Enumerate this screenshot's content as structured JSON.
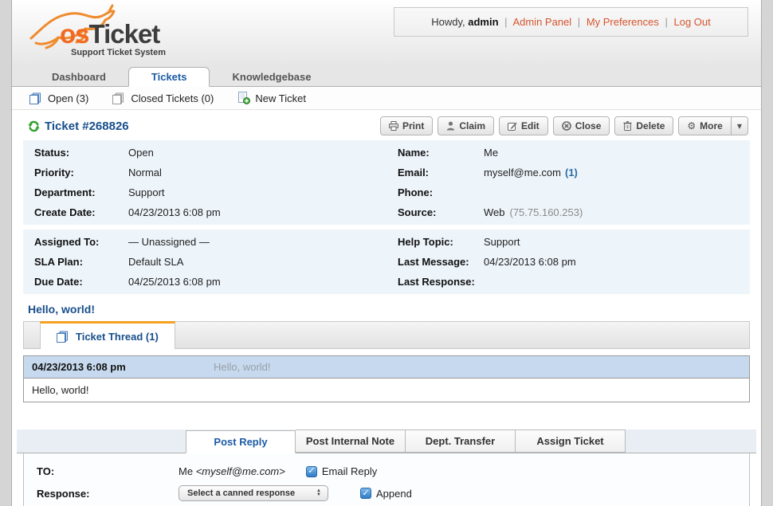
{
  "colors": {
    "link_orange": "#d4552e",
    "heading_blue": "#184f8c",
    "active_tab_blue": "#1d5ba5",
    "thread_tab_accent": "#f5a01e",
    "panel_bg": "#edf4fa",
    "message_header_bg": "#c6d9ee"
  },
  "header": {
    "logo_os": "os",
    "logo_ticket": "Ticket",
    "logo_subtitle": "Support Ticket System",
    "greeting": "Howdy,",
    "username": "admin",
    "sep": "|",
    "link_admin_panel": "Admin Panel",
    "link_my_preferences": "My Preferences",
    "link_log_out": "Log Out"
  },
  "nav": {
    "tab_dashboard": "Dashboard",
    "tab_tickets": "Tickets",
    "tab_knowledgebase": "Knowledgebase",
    "open_tickets": "Open (3)",
    "closed_tickets": "Closed Tickets (0)",
    "new_ticket": "New Ticket"
  },
  "ticket": {
    "title": "Ticket #268826",
    "btn_print": "Print",
    "btn_claim": "Claim",
    "btn_edit": "Edit",
    "btn_close": "Close",
    "btn_delete": "Delete",
    "btn_more": "More",
    "more_caret": "▼",
    "details": {
      "status_label": "Status:",
      "status": "Open",
      "priority_label": "Priority:",
      "priority": "Normal",
      "department_label": "Department:",
      "department": "Support",
      "create_date_label": "Create Date:",
      "create_date": "04/23/2013 6:08 pm",
      "name_label": "Name:",
      "name": "Me",
      "email_label": "Email:",
      "email": "myself@me.com",
      "email_count": "(1)",
      "phone_label": "Phone:",
      "phone": "",
      "source_label": "Source:",
      "source": "Web",
      "source_ip": "(75.75.160.253)",
      "assigned_label": "Assigned To:",
      "assigned": "— Unassigned —",
      "sla_label": "SLA Plan:",
      "sla": "Default SLA",
      "due_label": "Due Date:",
      "due": "04/25/2013 6:08 pm",
      "help_topic_label": "Help Topic:",
      "help_topic": "Support",
      "last_message_label": "Last Message:",
      "last_message": "04/23/2013 6:08 pm",
      "last_response_label": "Last Response:",
      "last_response": ""
    },
    "subject": "Hello, world!"
  },
  "thread": {
    "tab": "Ticket Thread (1)",
    "message_date": "04/23/2013 6:08 pm",
    "message_title": "Hello, world!",
    "message_body": "Hello, world!"
  },
  "reply": {
    "tab_post_reply": "Post Reply",
    "tab_internal_note": "Post Internal Note",
    "tab_dept_transfer": "Dept. Transfer",
    "tab_assign_ticket": "Assign Ticket",
    "to_label": "TO:",
    "to_name": "Me",
    "to_email": "<myself@me.com>",
    "email_reply_label": "Email Reply",
    "check_glyph": "✓",
    "response_label": "Response:",
    "canned_select_value": "Select a canned response",
    "append_label": "Append"
  }
}
